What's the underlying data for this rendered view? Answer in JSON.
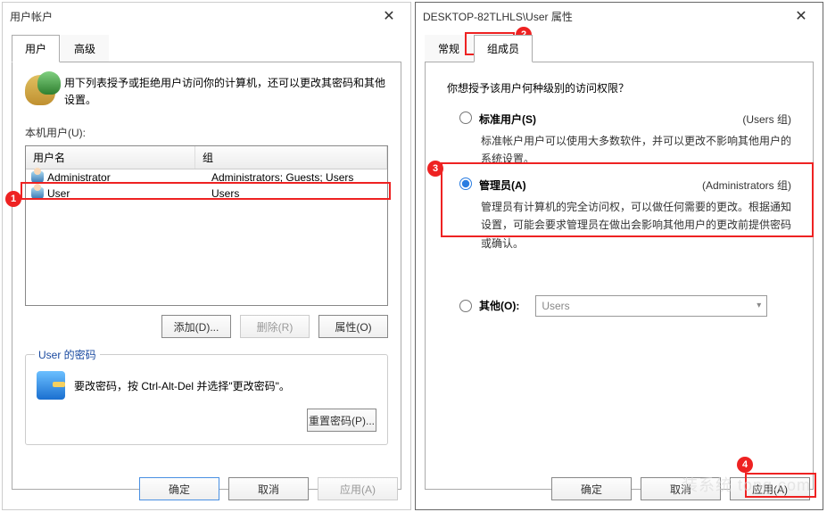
{
  "left_window": {
    "title": "用户帐户",
    "tabs": {
      "user": "用户",
      "advanced": "高级"
    },
    "intro": "用下列表授予或拒绝用户访问你的计算机，还可以更改其密码和其他设置。",
    "list_label": "本机用户(U):",
    "columns": {
      "name": "用户名",
      "group": "组"
    },
    "rows": [
      {
        "name": "Administrator",
        "group": "Administrators; Guests; Users"
      },
      {
        "name": "User",
        "group": "Users"
      }
    ],
    "buttons": {
      "add": "添加(D)...",
      "remove": "删除(R)",
      "props": "属性(O)"
    },
    "pwd_group": {
      "legend": "User 的密码",
      "text": "要改密码，按 Ctrl-Alt-Del 并选择\"更改密码\"。",
      "reset": "重置密码(P)..."
    },
    "dlg": {
      "ok": "确定",
      "cancel": "取消",
      "apply": "应用(A)"
    }
  },
  "right_window": {
    "title": "DESKTOP-82TLHLS\\User 属性",
    "tabs": {
      "general": "常规",
      "member": "组成员"
    },
    "question": "你想授予该用户何种级别的访问权限？",
    "standard": {
      "label": "标准用户(S)",
      "side": "(Users 组)",
      "desc": "标准帐户用户可以使用大多数软件，并可以更改不影响其他用户的系统设置。"
    },
    "admin": {
      "label": "管理员(A)",
      "side": "(Administrators 组)",
      "desc": "管理员有计算机的完全访问权，可以做任何需要的更改。根据通知设置，可能会要求管理员在做出会影响其他用户的更改前提供密码或确认。"
    },
    "other": {
      "label": "其他(O):",
      "value": "Users"
    },
    "dlg": {
      "ok": "确定",
      "cancel": "取消",
      "apply": "应用(A)"
    }
  },
  "watermark": "装系统 tong.com"
}
